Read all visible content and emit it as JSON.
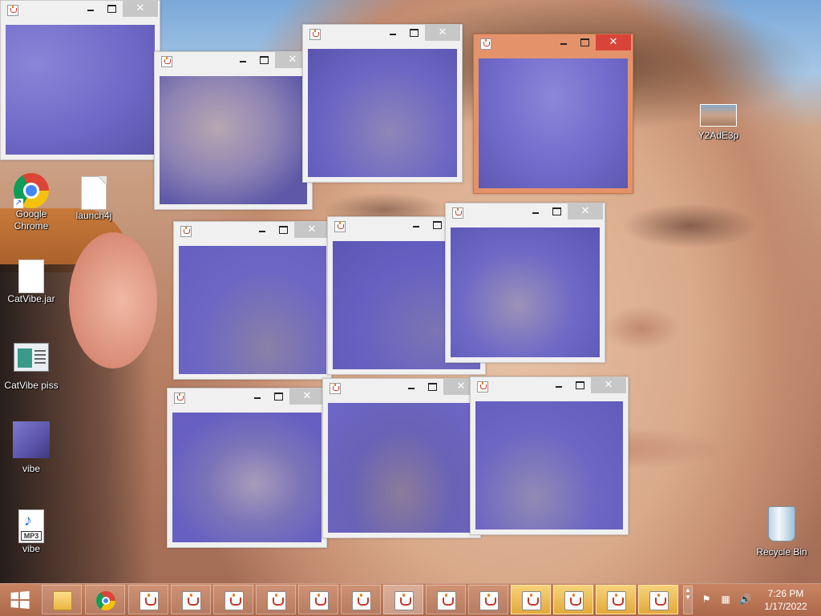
{
  "desktop_icons": {
    "chrome": "Google Chrome",
    "launch4j": "launch4j",
    "catvibe_jar": "CatVibe.jar",
    "catvibe_piss": "CatVibe piss",
    "vibe_image": "vibe",
    "vibe_mp3": "vibe",
    "mp3_tag": "MP3",
    "y2ade3p": "Y2AdE3p",
    "recycle_bin": "Recycle Bin"
  },
  "window_icons": {
    "minimize": "minimize-icon",
    "maximize": "maximize-icon",
    "close_glyph": "✕"
  },
  "taskbar": {
    "time": "7:26 PM",
    "date": "1/17/2022",
    "accent_color": "#c8825f",
    "highlight_color": "#e3a93b"
  }
}
